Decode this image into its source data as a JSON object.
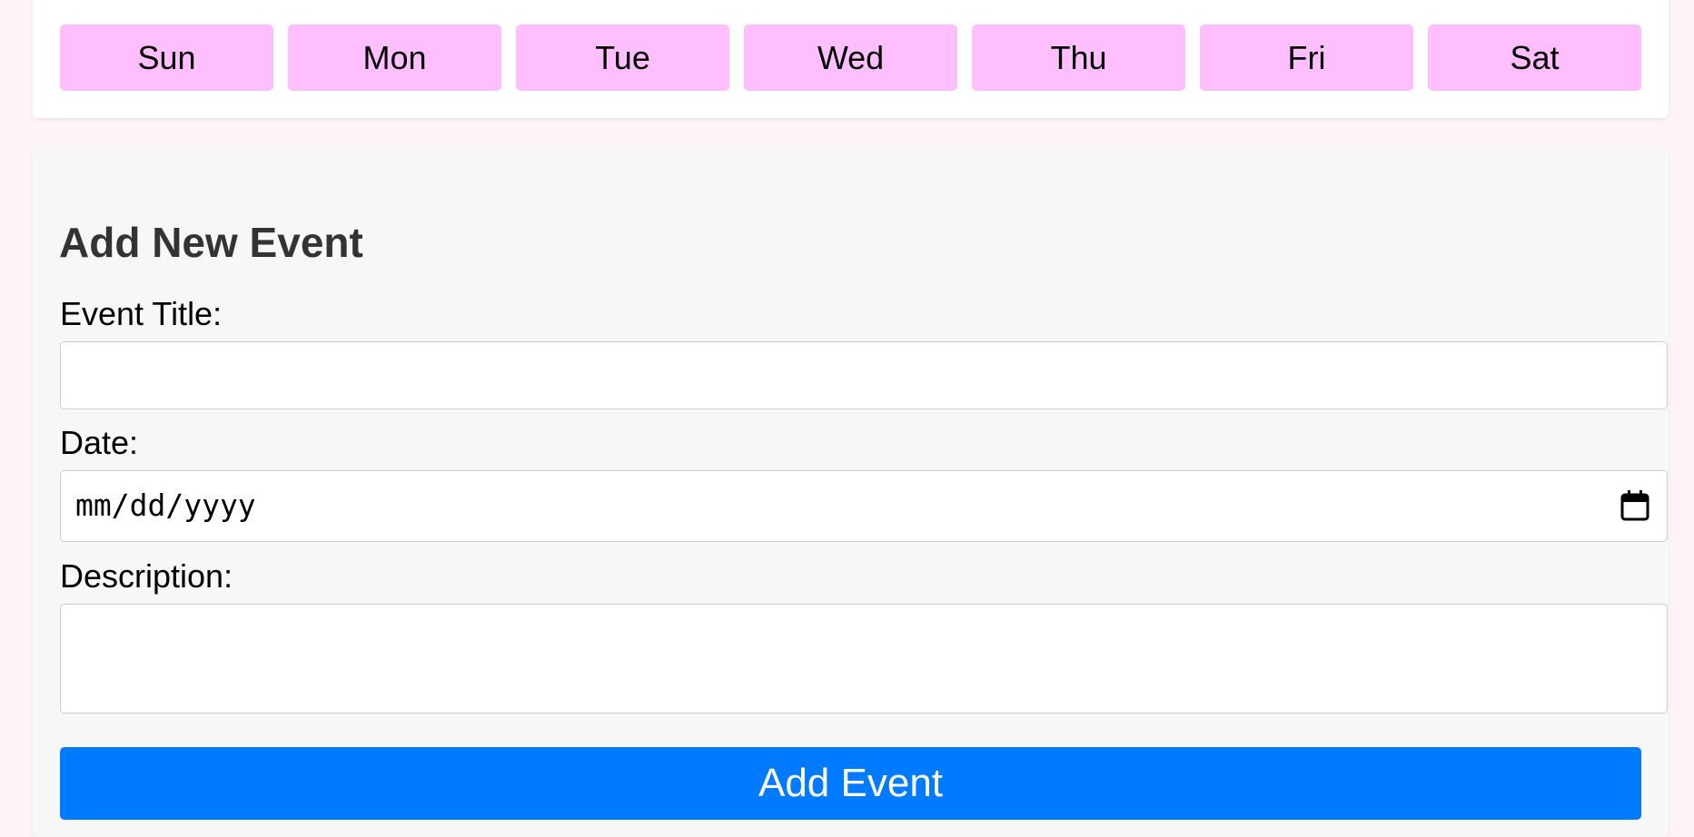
{
  "weekdays": [
    "Sun",
    "Mon",
    "Tue",
    "Wed",
    "Thu",
    "Fri",
    "Sat"
  ],
  "form": {
    "heading": "Add New Event",
    "title_label": "Event Title:",
    "title_value": "",
    "date_label": "Date:",
    "date_placeholder": "mm/dd/yyyy",
    "description_label": "Description:",
    "description_value": "",
    "submit_label": "Add Event"
  },
  "icons": {
    "date_picker": "calendar-icon",
    "textarea_resize": "resize-grip-icon"
  },
  "colors": {
    "page_background": "#fff5f8",
    "weekday_background": "#ffbfff",
    "form_background": "#f7f7f7",
    "button_background": "#007bff",
    "button_text": "#ffffff",
    "heading_text": "#333333"
  }
}
